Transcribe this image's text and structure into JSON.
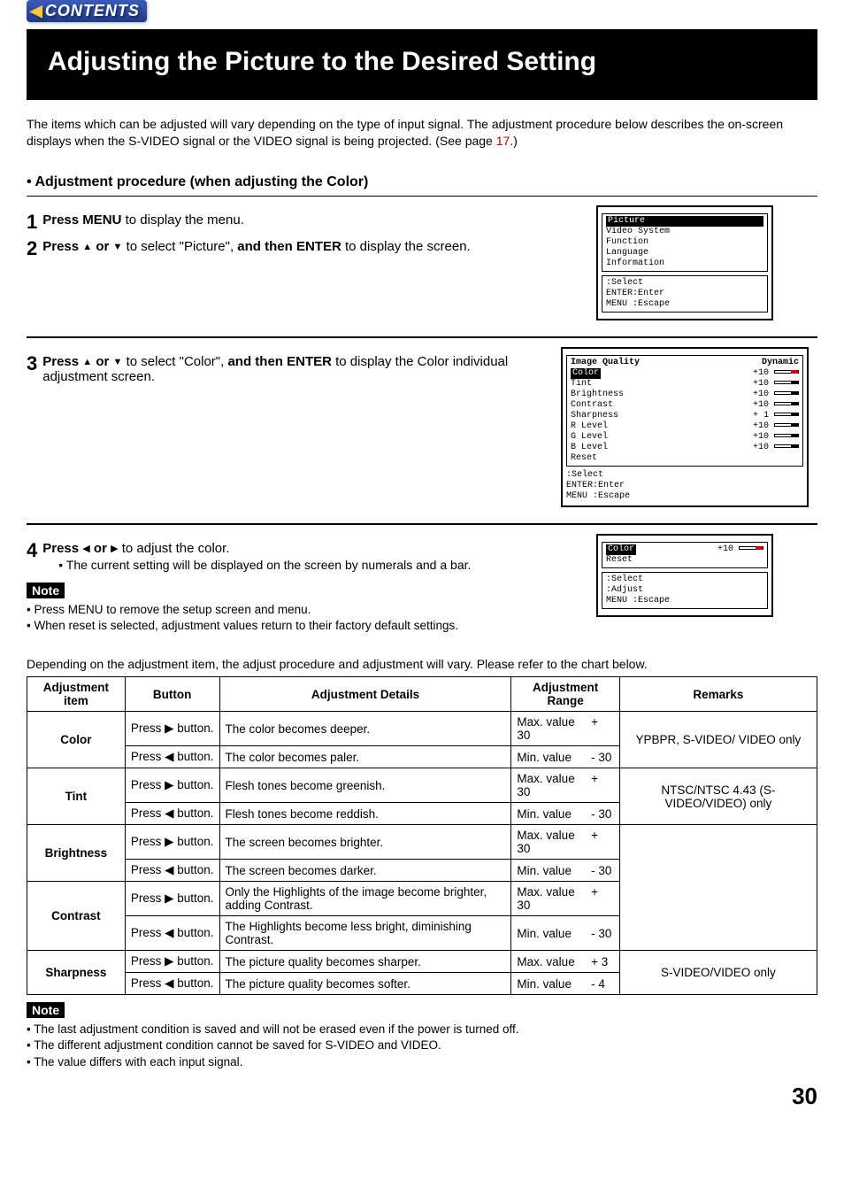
{
  "contents_button": "CONTENTS",
  "title": "Adjusting the Picture to the Desired Setting",
  "intro_text": "The items which can be adjusted will vary depending on the type of input signal. The adjustment procedure below describes the on-screen displays when the S-VIDEO signal or the VIDEO signal is being projected. (See page ",
  "intro_page_ref": "17",
  "intro_text_after": ".)",
  "section_heading": "• Adjustment procedure (when adjusting the Color)",
  "step1_num": "1",
  "step1_a": "Press MENU ",
  "step1_b": "to display the menu.",
  "step2_num": "2",
  "step2_a": "Press ",
  "step2_b": " or ",
  "step2_c": " to select \"Picture\", ",
  "step2_d": "and then ENTER ",
  "step2_e": "to display the screen.",
  "step3_num": "3",
  "step3_a": "Press ",
  "step3_b": " or ",
  "step3_c": " to select \"Color\", ",
  "step3_d": "and then ENTER ",
  "step3_e": "to display the Color individual adjustment screen.",
  "step4_num": "4",
  "step4_a": "Press ",
  "step4_b": " or ",
  "step4_c": "  to adjust the color.",
  "step4_detail": "• The current setting will be displayed on the screen by numerals and a bar.",
  "note_label": "Note",
  "notes1": [
    "• Press MENU to remove the setup screen and menu.",
    "• When reset is selected, adjustment values return to their factory default settings."
  ],
  "chart_intro": "Depending on the adjustment item, the adjust procedure and adjustment will vary. Please refer to the chart below.",
  "table": {
    "headers": [
      "Adjustment item",
      "Button",
      "Adjustment Details",
      "Adjustment Range",
      "Remarks"
    ],
    "rows": [
      {
        "item": "Color",
        "btn": "Press ▶ button.",
        "detail": "The color becomes deeper.",
        "range_l": "Max. value",
        "range_v": "+ 30",
        "remark": "YPBPR, S-VIDEO/ VIDEO only",
        "remark_rowspan": 2
      },
      {
        "btn": "Press ◀ button.",
        "detail": "The color becomes paler.",
        "range_l": "Min. value",
        "range_v": "- 30"
      },
      {
        "item": "Tint",
        "btn": "Press ▶ button.",
        "detail": "Flesh tones become greenish.",
        "range_l": "Max. value",
        "range_v": "+ 30",
        "remark": "NTSC/NTSC 4.43 (S-VIDEO/VIDEO) only",
        "remark_rowspan": 2
      },
      {
        "btn": "Press ◀ button.",
        "detail": "Flesh tones become reddish.",
        "range_l": "Min. value",
        "range_v": "- 30"
      },
      {
        "item": "Brightness",
        "btn": "Press ▶ button.",
        "detail": "The screen becomes brighter.",
        "range_l": "Max. value",
        "range_v": "+ 30",
        "remark": "",
        "remark_rowspan": 4
      },
      {
        "btn": "Press ◀ button.",
        "detail": "The screen becomes darker.",
        "range_l": "Min. value",
        "range_v": "- 30"
      },
      {
        "item": "Contrast",
        "btn": "Press ▶ button.",
        "detail": "Only the Highlights of the image become brighter, adding Contrast.",
        "range_l": "Max. value",
        "range_v": "+ 30"
      },
      {
        "btn": "Press ◀ button.",
        "detail": "The Highlights become less bright, diminishing Contrast.",
        "range_l": "Min. value",
        "range_v": "- 30"
      },
      {
        "item": "Sharpness",
        "btn": "Press ▶ button.",
        "detail": "The picture quality becomes sharper.",
        "range_l": "Max. value",
        "range_v": "+ 3",
        "remark": "S-VIDEO/VIDEO only",
        "remark_rowspan": 2
      },
      {
        "btn": "Press ◀ button.",
        "detail": "The picture quality becomes softer.",
        "range_l": "Min. value",
        "range_v": "- 4"
      }
    ]
  },
  "notes2": [
    "• The last adjustment condition is saved and will not be erased even if the power is turned off.",
    "• The different adjustment condition cannot be saved for S-VIDEO and VIDEO.",
    "• The value differs with each input signal."
  ],
  "page_number": "30",
  "osd1": {
    "items": [
      "Picture",
      "Video System",
      "Function",
      "Language",
      "Information"
    ],
    "hints": [
      "      :Select",
      "ENTER:Enter",
      "MENU :Escape"
    ]
  },
  "osd2": {
    "title_l": "Image Quality",
    "title_r": "Dynamic",
    "rows": [
      {
        "l": "Color",
        "v": "+10",
        "hl": true
      },
      {
        "l": "Tint",
        "v": "+10"
      },
      {
        "l": "Brightness",
        "v": "+10"
      },
      {
        "l": "Contrast",
        "v": "+10"
      },
      {
        "l": "Sharpness",
        "v": "+ 1"
      },
      {
        "l": "R Level",
        "v": "+10"
      },
      {
        "l": "G Level",
        "v": "+10"
      },
      {
        "l": "B Level",
        "v": "+10"
      },
      {
        "l": "Reset",
        "v": ""
      }
    ],
    "hints": [
      "      :Select",
      "ENTER:Enter",
      "MENU :Escape"
    ]
  },
  "osd3": {
    "rows": [
      {
        "l": "Color",
        "v": "+10",
        "hl": true
      },
      {
        "l": "Reset",
        "v": ""
      }
    ],
    "hints": [
      "      :Select",
      "      :Adjust",
      "MENU :Escape"
    ]
  }
}
